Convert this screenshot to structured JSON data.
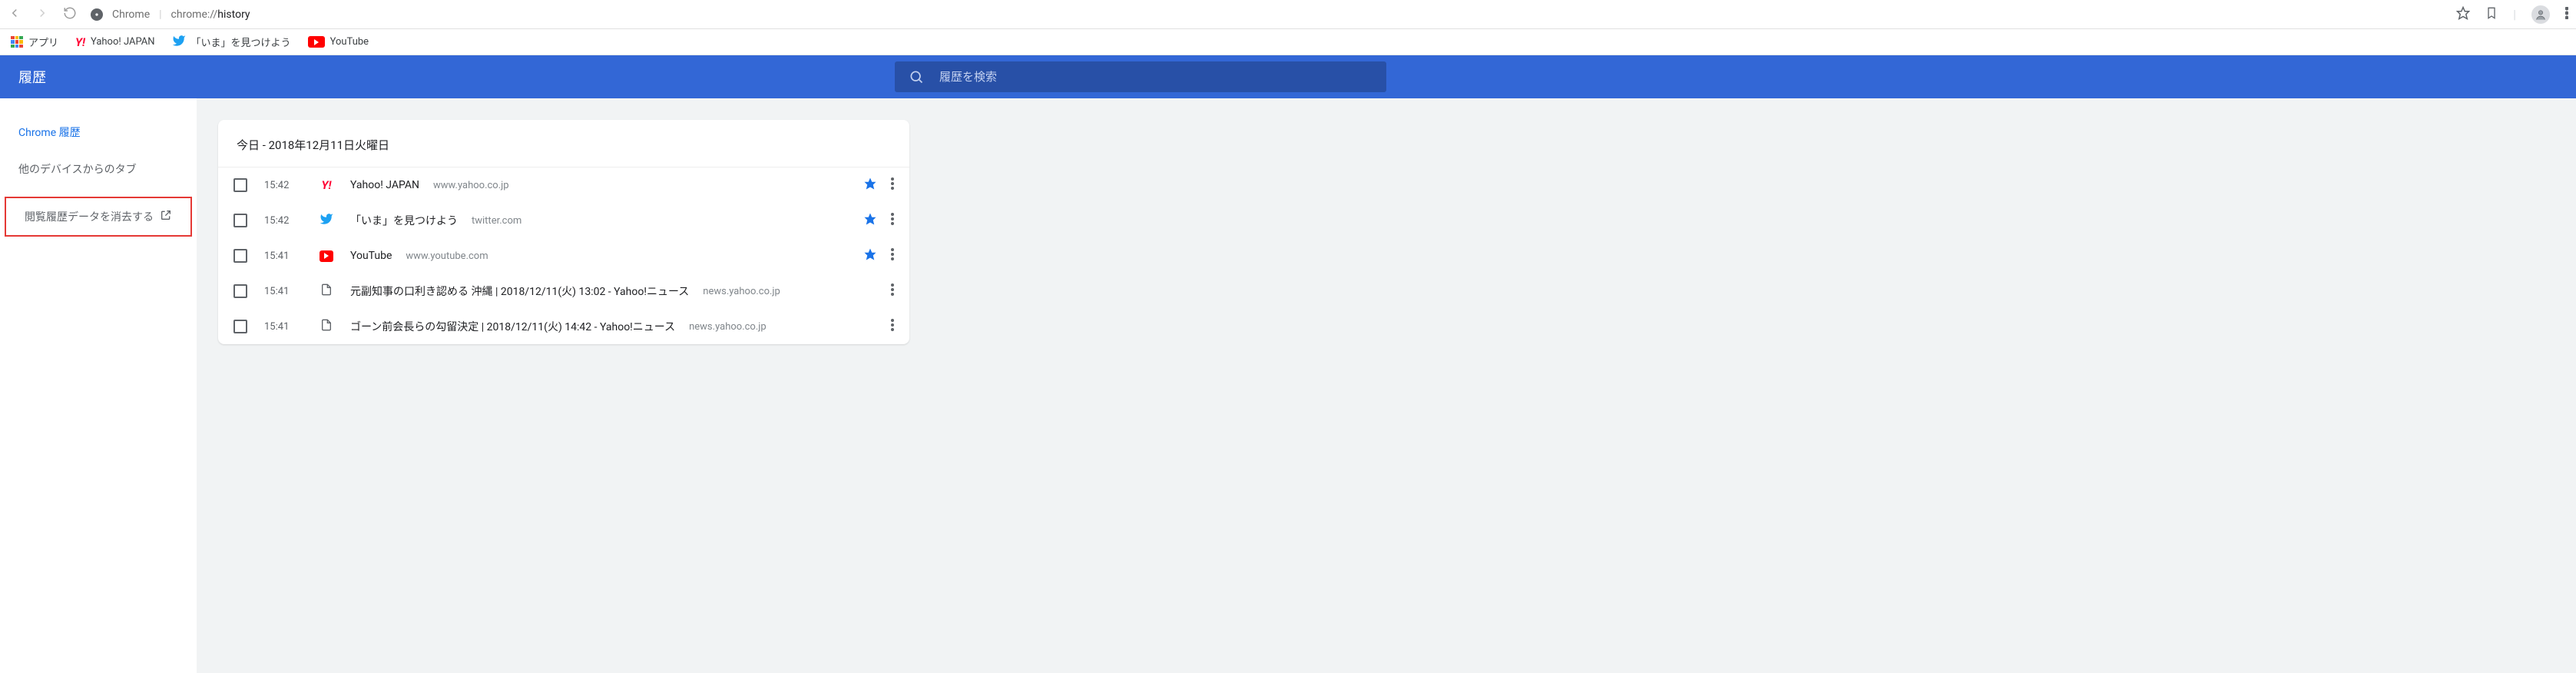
{
  "browser": {
    "product_label": "Chrome",
    "url_prefix": "chrome://",
    "url_path": "history"
  },
  "bookmarks": {
    "apps": "アプリ",
    "yahoo": "Yahoo! JAPAN",
    "twitter": "「いま」を見つけよう",
    "youtube": "YouTube"
  },
  "header": {
    "title": "履歴",
    "search_placeholder": "履歴を検索"
  },
  "sidebar": {
    "items": [
      {
        "label": "Chrome 履歴",
        "active": true
      },
      {
        "label": "他のデバイスからのタブ",
        "active": false
      },
      {
        "label": "閲覧履歴データを消去する",
        "active": false,
        "external": true,
        "highlighted": true
      }
    ]
  },
  "history": {
    "date_heading": "今日 - 2018年12月11日火曜日",
    "entries": [
      {
        "time": "15:42",
        "icon": "yahoo",
        "title": "Yahoo! JAPAN",
        "url": "www.yahoo.co.jp",
        "bookmarked": true
      },
      {
        "time": "15:42",
        "icon": "twitter",
        "title": "「いま」を見つけよう",
        "url": "twitter.com",
        "bookmarked": true
      },
      {
        "time": "15:41",
        "icon": "youtube",
        "title": "YouTube",
        "url": "www.youtube.com",
        "bookmarked": true
      },
      {
        "time": "15:41",
        "icon": "page",
        "title": "元副知事の口利き認める 沖縄 | 2018/12/11(火) 13:02 - Yahoo!ニュース",
        "url": "news.yahoo.co.jp",
        "bookmarked": false
      },
      {
        "time": "15:41",
        "icon": "page",
        "title": "ゴーン前会長らの勾留決定 | 2018/12/11(火) 14:42 - Yahoo!ニュース",
        "url": "news.yahoo.co.jp",
        "bookmarked": false
      }
    ]
  }
}
